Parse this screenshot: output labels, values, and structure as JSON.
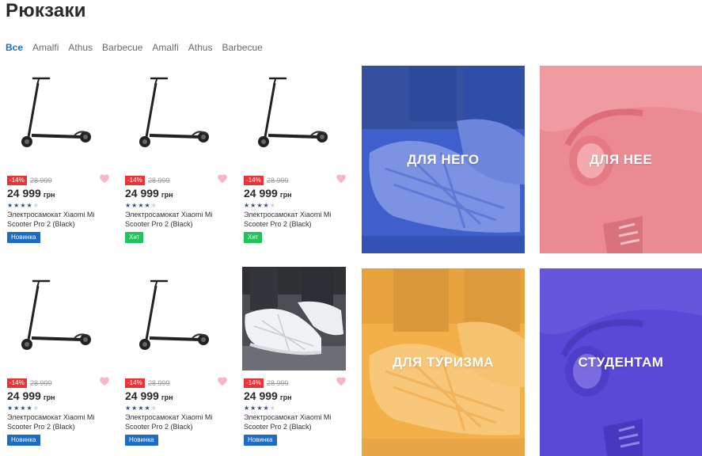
{
  "page": {
    "title": "Рюкзаки"
  },
  "tabs": [
    {
      "label": "Все",
      "active": true
    },
    {
      "label": "Amalfi"
    },
    {
      "label": "Athus"
    },
    {
      "label": "Barbecue"
    },
    {
      "label": "Amalfi"
    },
    {
      "label": "Athus"
    },
    {
      "label": "Barbecue"
    }
  ],
  "products": [
    {
      "discount": "-14%",
      "old_price": "28 999",
      "price": "24 999",
      "currency": "грн",
      "rating": 4,
      "name": "Электросамокат Xiaomi Mi Scooter Pro 2 (Black)",
      "badge": "Новинка",
      "badge_type": "new",
      "image": "scooter"
    },
    {
      "discount": "-14%",
      "old_price": "28 999",
      "price": "24 999",
      "currency": "грн",
      "rating": 4,
      "name": "Электросамокат Xiaomi Mi Scooter Pro 2 (Black)",
      "badge": "Хит",
      "badge_type": "hit",
      "image": "scooter"
    },
    {
      "discount": "-14%",
      "old_price": "28 999",
      "price": "24 999",
      "currency": "грн",
      "rating": 4,
      "name": "Электросамокат Xiaomi Mi Scooter Pro 2 (Black)",
      "badge": "Хит",
      "badge_type": "hit",
      "image": "scooter"
    },
    {
      "discount": "-14%",
      "old_price": "28 999",
      "price": "24 999",
      "currency": "грн",
      "rating": 4,
      "name": "Электросамокат Xiaomi Mi Scooter Pro 2 (Black)",
      "badge": "Новинка",
      "badge_type": "new",
      "image": "scooter"
    },
    {
      "discount": "-14%",
      "old_price": "28 999",
      "price": "24 999",
      "currency": "грн",
      "rating": 4,
      "name": "Электросамокат Xiaomi Mi Scooter Pro 2 (Black)",
      "badge": "Новинка",
      "badge_type": "new",
      "image": "scooter"
    },
    {
      "discount": "-14%",
      "old_price": "28 999",
      "price": "24 999",
      "currency": "грн",
      "rating": 4,
      "name": "Электросамокат Xiaomi Mi Scooter Pro 2 (Black)",
      "badge": "Новинка",
      "badge_type": "new",
      "image": "sneakers-photo"
    }
  ],
  "categories": [
    {
      "label": "ДЛЯ НЕГО",
      "color": "#3f5fcc",
      "image": "sneakers"
    },
    {
      "label": "ДЛЯ НЕЕ",
      "color": "#ec8a93",
      "image": "headphones"
    },
    {
      "label": "ДЛЯ ТУРИЗМА",
      "color": "#f4b048",
      "image": "sneakers"
    },
    {
      "label": "СТУДЕНТАМ",
      "color": "#5a49d6",
      "image": "headphones"
    }
  ],
  "icons": {
    "heart": "heart-icon",
    "star": "star-icon"
  },
  "colors": {
    "accent": "#1e6cc8",
    "discount": "#e4363a",
    "hit": "#1fc45a",
    "heart": "#f7b6c2",
    "star_on": "#2d4f86"
  }
}
